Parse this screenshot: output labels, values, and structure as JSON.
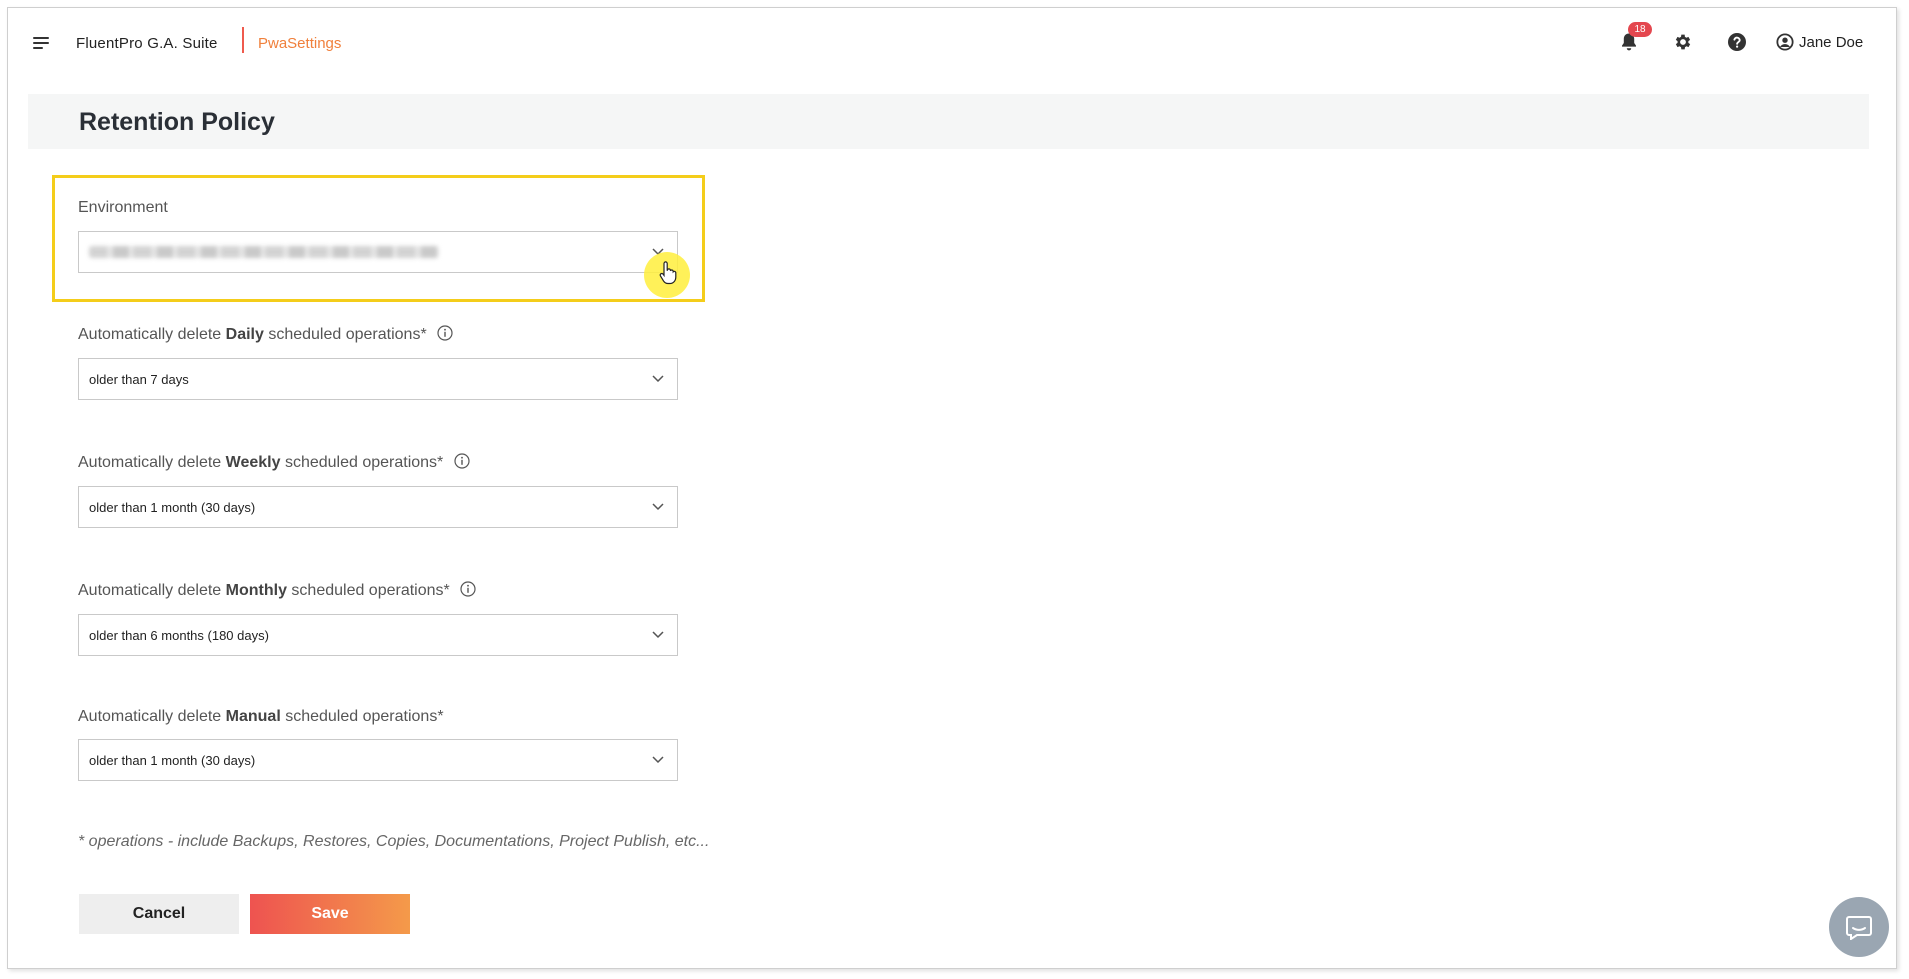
{
  "header": {
    "app_name": "FluentPro G.A. Suite",
    "module_name": "PwaSettings",
    "notification_count": "18",
    "user_name": "Jane Doe",
    "brand_color": "#ef5a4d",
    "module_color": "#f0803c"
  },
  "page": {
    "title": "Retention Policy"
  },
  "form": {
    "environment": {
      "label": "Environment",
      "value_obscured": true
    },
    "fields": [
      {
        "prefix": "Automatically delete ",
        "bold": "Daily",
        "suffix": " scheduled operations*",
        "has_info": true,
        "value": "older than 7 days"
      },
      {
        "prefix": "Automatically delete ",
        "bold": "Weekly",
        "suffix": " scheduled operations*",
        "has_info": true,
        "value": "older than 1 month (30 days)"
      },
      {
        "prefix": "Automatically delete ",
        "bold": "Monthly",
        "suffix": " scheduled operations*",
        "has_info": true,
        "value": "older than 6 months (180 days)"
      },
      {
        "prefix": "Automatically delete ",
        "bold": "Manual",
        "suffix": " scheduled operations*",
        "has_info": false,
        "value": "older than 1 month (30 days)"
      }
    ],
    "footnote": "* operations - include Backups, Restores, Copies, Documentations, Project Publish, etc...",
    "cancel_label": "Cancel",
    "save_label": "Save"
  },
  "icons": {
    "menu": "hamburger-icon",
    "notifications": "bell-icon",
    "settings": "gear-icon",
    "help": "help-icon",
    "user": "user-circle-icon",
    "chat": "chat-icon",
    "info": "info-icon",
    "dropdown": "chevron-down-icon"
  }
}
